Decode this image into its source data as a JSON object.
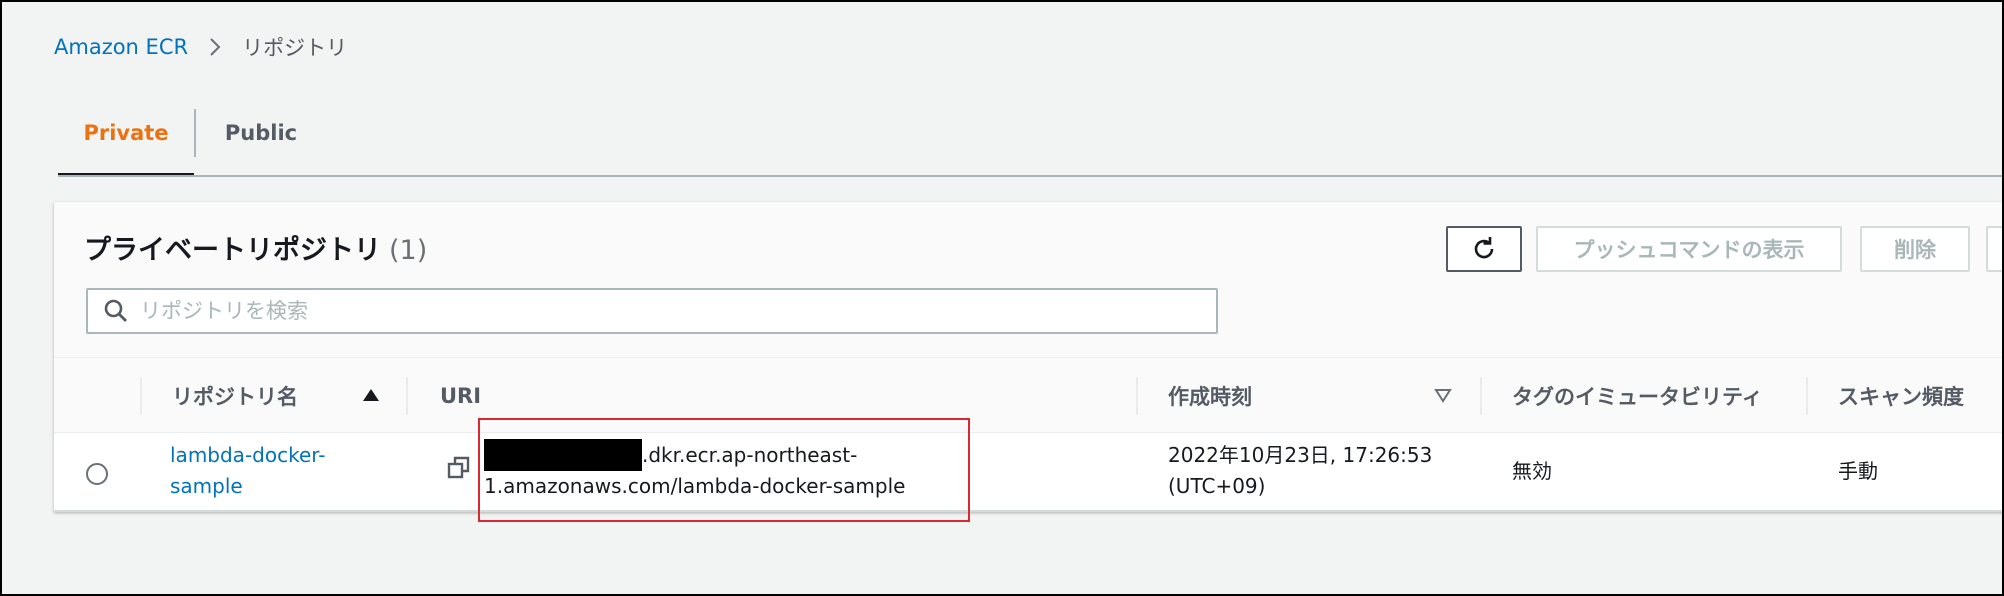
{
  "breadcrumb": {
    "root": "Amazon ECR",
    "current": "リポジトリ"
  },
  "tabs": {
    "private": "Private",
    "public": "Public"
  },
  "panel": {
    "title": "プライベートリポジトリ",
    "count": "(1)"
  },
  "buttons": {
    "push_commands": "プッシュコマンドの表示",
    "delete": "削除"
  },
  "search": {
    "placeholder": "リポジトリを検索",
    "value": ""
  },
  "table": {
    "columns": {
      "name": "リポジトリ名",
      "uri": "URI",
      "created": "作成時刻",
      "tag_immutability": "タグのイミュータビリティ",
      "scan_frequency": "スキャン頻度"
    },
    "rows": [
      {
        "name_line1": "lambda-docker-",
        "name_line2": "sample",
        "uri_line1_suffix": ".dkr.ecr.ap-northeast-",
        "uri_line2": "1.amazonaws.com/lambda-docker-sample",
        "created_line1": "2022年10月23日, 17:26:53",
        "created_line2": "(UTC+09)",
        "tag_immutability": "無効",
        "scan_frequency": "手動"
      }
    ]
  },
  "colors": {
    "accent": "#ec7211",
    "link": "#0073bb",
    "highlight": "#d9282f"
  }
}
